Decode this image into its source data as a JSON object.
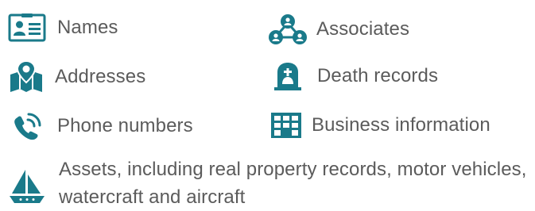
{
  "accent_color": "#1a7a8a",
  "text_color": "#5b5b5b",
  "items": [
    {
      "icon": "id-card-icon",
      "label": "Names"
    },
    {
      "icon": "map-pin-icon",
      "label": "Addresses"
    },
    {
      "icon": "phone-icon",
      "label": "Phone numbers"
    },
    {
      "icon": "network-people-icon",
      "label": "Associates"
    },
    {
      "icon": "tombstone-icon",
      "label": "Death records"
    },
    {
      "icon": "building-icon",
      "label": "Business information"
    },
    {
      "icon": "sailboat-icon",
      "label": "Assets, including real property records, motor vehicles, watercraft and aircraft"
    }
  ]
}
